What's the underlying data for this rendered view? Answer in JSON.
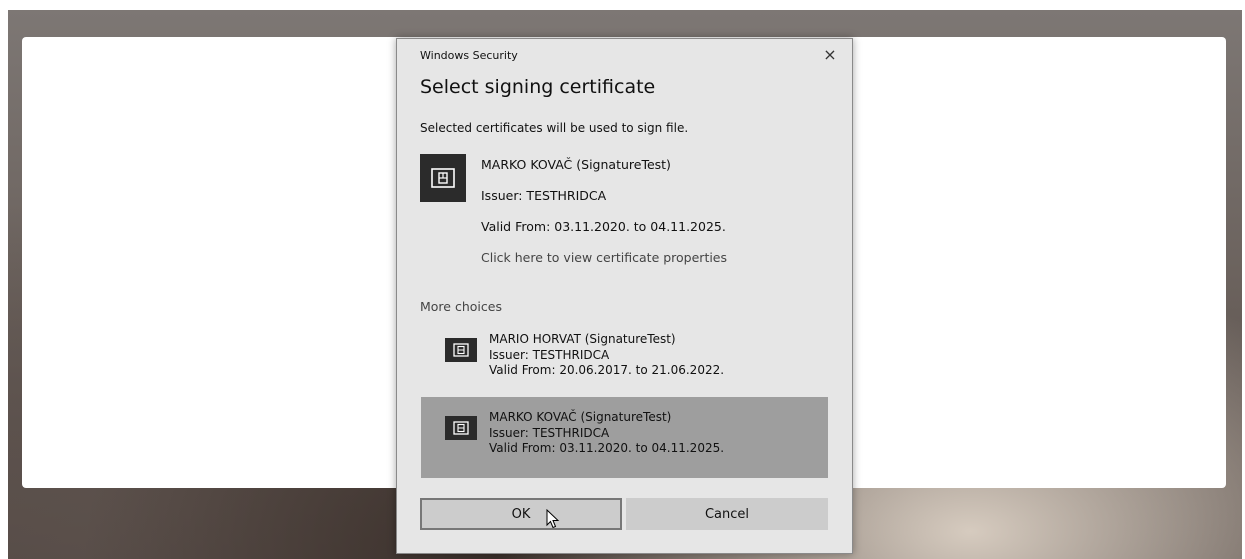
{
  "dialog": {
    "app_title": "Windows Security",
    "close_glyph": "×",
    "heading": "Select signing certificate",
    "description": "Selected certificates will be used to sign file.",
    "selected_certificate": {
      "icon": "certificate-icon",
      "name": "MARKO KOVAČ (SignatureTest)",
      "issuer": "Issuer: TESTHRIDCA",
      "valid": "Valid From: 03.11.2020. to 04.11.2025.",
      "properties_link": "Click here to view certificate properties"
    },
    "more_choices_label": "More choices",
    "choices": [
      {
        "name": "MARIO HORVAT (SignatureTest)",
        "issuer": "Issuer: TESTHRIDCA",
        "valid": "Valid From: 20.06.2017. to 21.06.2022.",
        "selected": false
      },
      {
        "name": "MARKO KOVAČ (SignatureTest)",
        "issuer": "Issuer: TESTHRIDCA",
        "valid": "Valid From: 03.11.2020. to 04.11.2025.",
        "selected": true
      }
    ],
    "ok_label": "OK",
    "cancel_label": "Cancel"
  },
  "colors": {
    "dialog_bg": "#e6e6e6",
    "selected_row": "#9e9e9e",
    "button_bg": "#cccccc",
    "icon_bg": "#2b2b2b"
  }
}
